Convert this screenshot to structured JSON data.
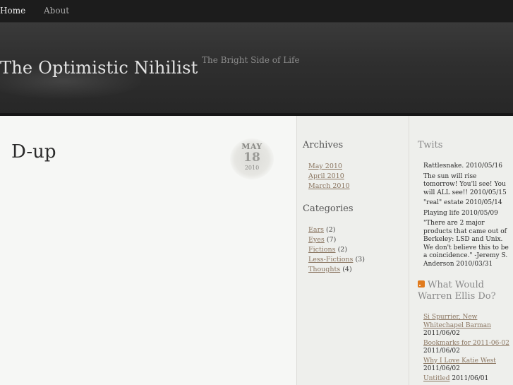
{
  "nav": {
    "home": "Home",
    "about": "About"
  },
  "header": {
    "title": "The Optimistic Nihilist",
    "tagline": "The Bright Side of Life"
  },
  "post": {
    "title": "D-up",
    "date": {
      "month": "MAY",
      "day": "18",
      "year": "2010"
    }
  },
  "archives": {
    "title": "Archives",
    "items": [
      "May 2010",
      "April 2010",
      "March 2010"
    ]
  },
  "categories": {
    "title": "Categories",
    "items": [
      {
        "name": "Ears",
        "count": "(2)"
      },
      {
        "name": "Eyes",
        "count": "(7)"
      },
      {
        "name": "Fictions",
        "count": "(2)"
      },
      {
        "name": "Less-Fictions",
        "count": "(3)"
      },
      {
        "name": "Thoughts",
        "count": "(4)"
      }
    ]
  },
  "twits": {
    "title": "Twits",
    "items": [
      "Rattlesnake. 2010/05/16",
      "The sun will rise tomorrow! You'll see! You will ALL see!! 2010/05/15",
      "\"real\" estate 2010/05/14",
      "Playing life 2010/05/09",
      "\"There are 2 major products that came out of Berkeley: LSD and Unix. We don't believe this to be a coincidence.\" -Jeremy S. Anderson 2010/03/31"
    ]
  },
  "wwed": {
    "title": "What Would Warren Ellis Do?",
    "icon": "rss-icon",
    "items": [
      {
        "link": "Si Spurrier, New Whitechapel Barman",
        "date": "2011/06/02"
      },
      {
        "link": "Bookmarks for 2011-06-02",
        "date": "2011/06/02"
      },
      {
        "link": "Why I Love Katie West",
        "date": "2011/06/02"
      },
      {
        "link": "Untitled",
        "date": "2011/06/01"
      }
    ]
  },
  "colors": {
    "nav_bg": "#1c1c1c",
    "header_bg": "#2f2f2f",
    "content_bg": "#f6f7f5",
    "link": "#8a7560",
    "rss": "#e07a1c"
  }
}
